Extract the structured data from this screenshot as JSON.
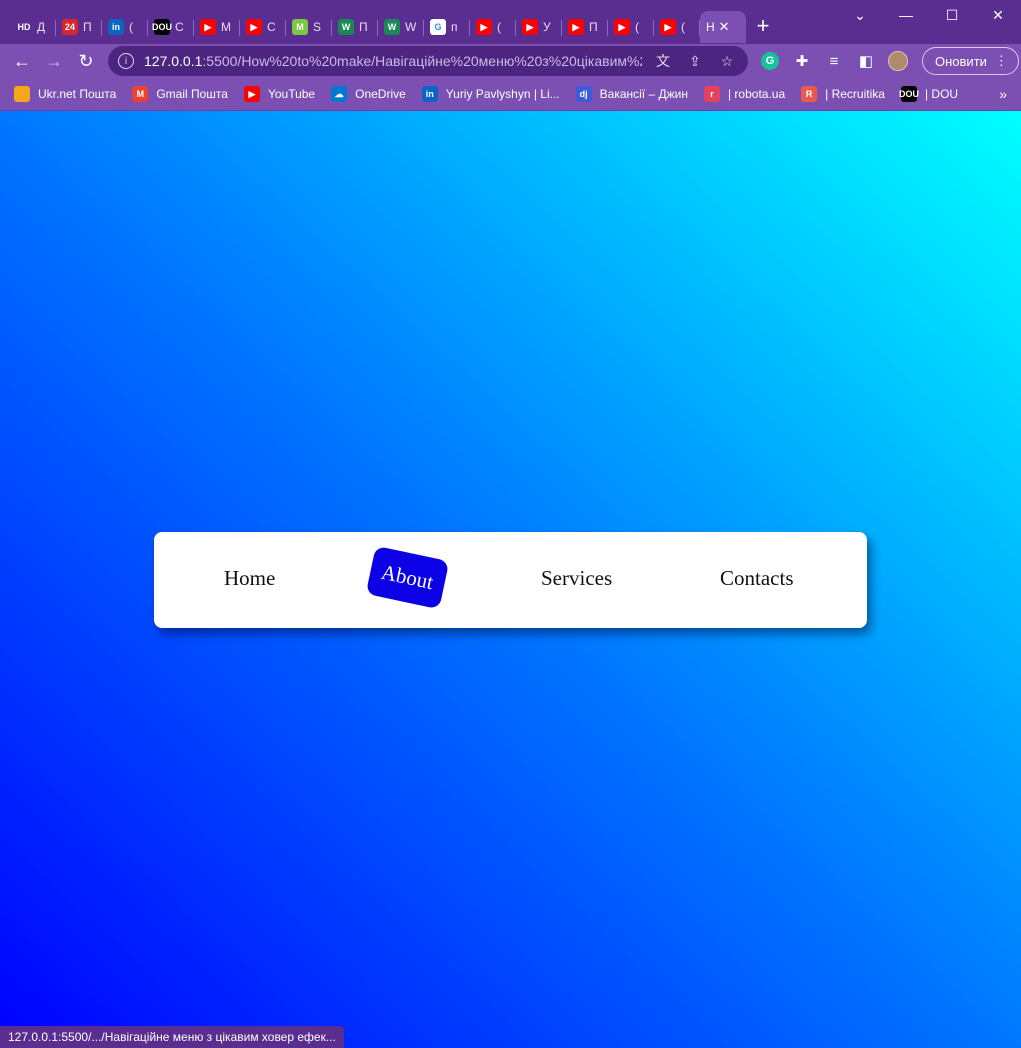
{
  "browser": {
    "tabs": [
      {
        "favicon": "hd-icon",
        "fav_text": "HD",
        "fav_color": "#5a2d91",
        "label": "Д"
      },
      {
        "favicon": "24-icon",
        "fav_text": "24",
        "fav_color": "#d7262e",
        "label": "П"
      },
      {
        "favicon": "linkedin-icon",
        "fav_text": "in",
        "fav_color": "#0a66c2",
        "label": "("
      },
      {
        "favicon": "dou-icon",
        "fav_text": "DOU",
        "fav_color": "#000000",
        "label": "С"
      },
      {
        "favicon": "youtube-icon",
        "fav_text": "▶",
        "fav_color": "#ff0000",
        "label": "M"
      },
      {
        "favicon": "youtube-icon",
        "fav_text": "▶",
        "fav_color": "#ff0000",
        "label": "C"
      },
      {
        "favicon": "m-icon",
        "fav_text": "M",
        "fav_color": "#7ac943",
        "label": "S"
      },
      {
        "favicon": "w-icon",
        "fav_text": "W",
        "fav_color": "#1a8754",
        "label": "П"
      },
      {
        "favicon": "w-icon",
        "fav_text": "W",
        "fav_color": "#1a8754",
        "label": "W"
      },
      {
        "favicon": "google-icon",
        "fav_text": "G",
        "fav_color": "#ffffff",
        "label": "п"
      },
      {
        "favicon": "youtube-icon",
        "fav_text": "▶",
        "fav_color": "#ff0000",
        "label": "("
      },
      {
        "favicon": "youtube-icon",
        "fav_text": "▶",
        "fav_color": "#ff0000",
        "label": "У"
      },
      {
        "favicon": "youtube-icon",
        "fav_text": "▶",
        "fav_color": "#ff0000",
        "label": "П"
      },
      {
        "favicon": "youtube-icon",
        "fav_text": "▶",
        "fav_color": "#ff0000",
        "label": "("
      },
      {
        "favicon": "youtube-icon",
        "fav_text": "▶",
        "fav_color": "#ff0000",
        "label": "("
      }
    ],
    "active_tab": {
      "label": "Н",
      "close": "✕"
    },
    "new_tab": "+",
    "window_controls": {
      "minimize": "—",
      "maximize": "☐",
      "close": "✕",
      "dropdown": "⌄"
    },
    "url_host": "127.0.0.1",
    "url_path": ":5500/How%20to%20make/Навігаційне%20меню%20з%20цікавим%2...",
    "update_button": "Оновити",
    "bookmarks": [
      {
        "label": "Ukr.net Пошта",
        "icon": "ukrnet-icon",
        "fav_text": "",
        "color": "#f6a61b"
      },
      {
        "label": "Gmail Пошта",
        "icon": "gmail-icon",
        "fav_text": "M",
        "color": "#ea4335"
      },
      {
        "label": "YouTube",
        "icon": "youtube-icon",
        "fav_text": "▶",
        "color": "#ff0000"
      },
      {
        "label": "OneDrive",
        "icon": "onedrive-icon",
        "fav_text": "☁",
        "color": "#0078d4"
      },
      {
        "label": "Yuriy Pavlyshyn | Li...",
        "icon": "linkedin-icon",
        "fav_text": "in",
        "color": "#0a66c2"
      },
      {
        "label": "Вакансії – Джин",
        "icon": "djinni-icon",
        "fav_text": "dj",
        "color": "#3b5bdb"
      },
      {
        "label": "| robota.ua",
        "icon": "robota-icon",
        "fav_text": "r",
        "color": "#e4405f"
      },
      {
        "label": "| Recruitika",
        "icon": "recruitika-icon",
        "fav_text": "R",
        "color": "#e85a4f"
      },
      {
        "label": "| DOU",
        "icon": "dou-icon",
        "fav_text": "DOU",
        "color": "#000000"
      }
    ],
    "bookmarks_more": "»",
    "status_text": "127.0.0.1:5500/.../Навігаційне меню з цікавим ховер ефек..."
  },
  "page": {
    "gradient": [
      "#0000ff",
      "#0077ff",
      "#00ffff"
    ],
    "menu": {
      "items": [
        "Home",
        "About",
        "Services",
        "Contacts"
      ],
      "active_index": 1,
      "active_color": "#0b00e6"
    }
  }
}
